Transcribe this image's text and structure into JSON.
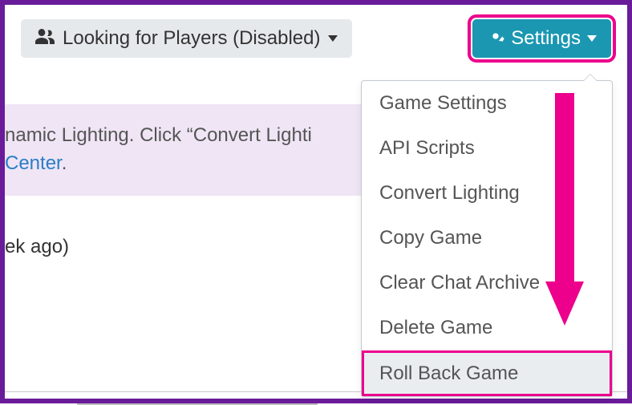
{
  "colors": {
    "frame": "#6a1b9a",
    "highlight": "#ec008c",
    "settings_bg": "#1b97b2",
    "notice_bg": "#efe5f5",
    "link": "#2a7ec7"
  },
  "toolbar": {
    "lfp_label": "Looking for Players (Disabled)",
    "settings_label": "Settings"
  },
  "notice": {
    "line1_fragment": "namic Lighting. Click “Convert Lighti",
    "link_fragment": " Center",
    "trailing": "."
  },
  "activity": {
    "fragment": "ek ago)"
  },
  "dropdown": {
    "items": [
      {
        "label": "Game Settings",
        "highlighted": false
      },
      {
        "label": "API Scripts",
        "highlighted": false
      },
      {
        "label": "Convert Lighting",
        "highlighted": false
      },
      {
        "label": "Copy Game",
        "highlighted": false
      },
      {
        "label": "Clear Chat Archive",
        "highlighted": false
      },
      {
        "label": "Delete Game",
        "highlighted": false
      },
      {
        "label": "Roll Back Game",
        "highlighted": true
      }
    ]
  }
}
